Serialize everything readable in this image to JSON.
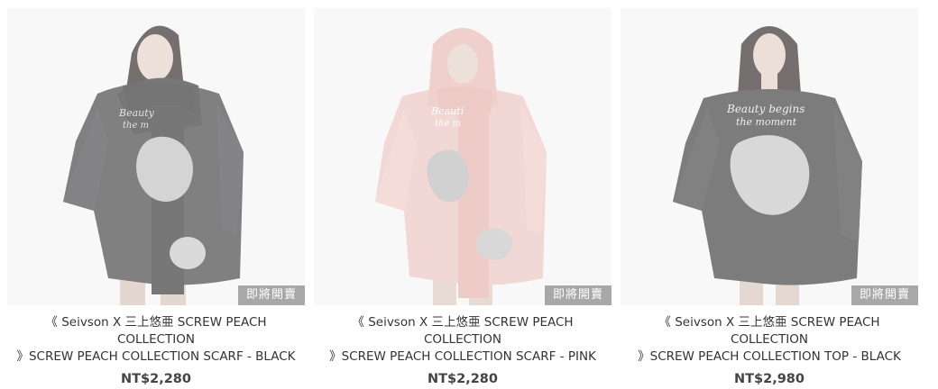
{
  "products": [
    {
      "name": "《 Seivson X 三上悠亜 SCREW PEACH COLLECTION\n》SCREW PEACH COLLECTION SCARF - BLACK",
      "price": "NT$2,280",
      "badge": "即將開賣",
      "garment_color": "#3c3c3e",
      "print_text": "Beauty begins the moment"
    },
    {
      "name": "《 Seivson X 三上悠亜 SCREW PEACH COLLECTION\n》SCREW PEACH COLLECTION SCARF - PINK",
      "price": "NT$2,280",
      "badge": "即將開賣",
      "garment_color": "#e9b9b4",
      "print_text": "Beauty begins the moment"
    },
    {
      "name": "《 Seivson X 三上悠亜 SCREW PEACH COLLECTION\n》SCREW PEACH COLLECTION TOP - BLACK",
      "price": "NT$2,980",
      "badge": "即將開賣",
      "garment_color": "#363638",
      "print_text": "Beauty begins the moment"
    }
  ]
}
